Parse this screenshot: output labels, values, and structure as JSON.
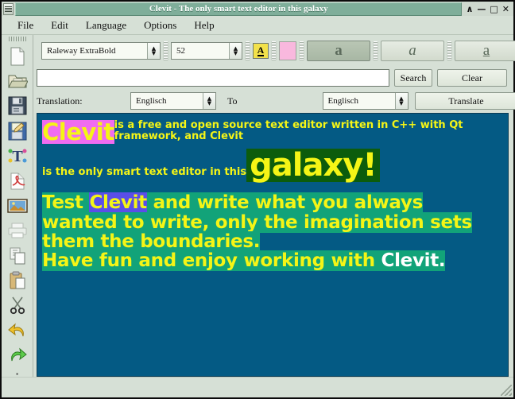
{
  "window": {
    "title": "Clevit - The only smart text editor in this galaxy",
    "controls": [
      {
        "name": "shade-button",
        "glyph": "∧"
      },
      {
        "name": "minimize-button",
        "glyph": "—"
      },
      {
        "name": "maximize-button",
        "glyph": "□"
      },
      {
        "name": "close-button",
        "glyph": "✕"
      }
    ],
    "system_menu_icon": "window-menu-icon"
  },
  "menubar": {
    "items": [
      {
        "label": "File"
      },
      {
        "label": "Edit"
      },
      {
        "label": "Language"
      },
      {
        "label": "Options"
      },
      {
        "label": "Help"
      }
    ]
  },
  "left_toolbar": {
    "items": [
      {
        "name": "new-file-icon",
        "title": "New"
      },
      {
        "name": "open-folder-icon",
        "title": "Open"
      },
      {
        "name": "save-icon",
        "title": "Save"
      },
      {
        "name": "save-as-icon",
        "title": "Save As"
      },
      {
        "name": "font-icon",
        "title": "Font"
      },
      {
        "name": "export-pdf-icon",
        "title": "Export PDF"
      },
      {
        "name": "insert-image-icon",
        "title": "Insert Image"
      },
      {
        "name": "print-icon",
        "title": "Print"
      },
      {
        "name": "copy-icon",
        "title": "Copy"
      },
      {
        "name": "paste-icon",
        "title": "Paste"
      },
      {
        "name": "cut-scissors-icon",
        "title": "Cut"
      },
      {
        "name": "undo-arrow-icon",
        "title": "Undo"
      },
      {
        "name": "redo-arrow-icon",
        "title": "Redo"
      }
    ]
  },
  "format_toolbar": {
    "font_family": "Raleway ExtraBold",
    "font_size": "52",
    "text_color_label": "A",
    "text_color": "#f2e14a",
    "highlight_color": "#f9b8de",
    "bold_label": "a",
    "italic_label": "a",
    "underline_label": "a",
    "bold_active": true
  },
  "search_row": {
    "query": "",
    "placeholder": "",
    "search_label": "Search",
    "clear_label": "Clear"
  },
  "translation_row": {
    "label": "Translation:",
    "source_language": "Englisch",
    "to_label": "To",
    "target_language": "Englisch",
    "translate_label": "Translate"
  },
  "editor": {
    "background": "#045a84",
    "paragraph1": {
      "word": "Clevit",
      "rest": "is a free and open source text editor written in C++ with Qt framework, and Clevit"
    },
    "paragraph2": {
      "lead": "is the only smart text editor in this",
      "word": "galaxy!"
    },
    "paragraph3": {
      "line1_a": "Test ",
      "line1_word": "Clevit",
      "line1_b": " and write what you always",
      "line2": "wanted to write, only the imagination sets",
      "line3": "them the boundaries.",
      "line4_a": "Have fun and enjoy working with ",
      "line4_word": "Clevit."
    },
    "colors": {
      "highlight_magenta": "#f06cf0",
      "highlight_green_dark": "#0c5c0c",
      "highlight_teal": "#12a379",
      "highlight_blue": "#5a4ee8",
      "text_yellow": "#f5f516",
      "text_white": "#ffffff"
    }
  },
  "statusbar": {
    "resize_grip": "resize-grip-icon"
  }
}
